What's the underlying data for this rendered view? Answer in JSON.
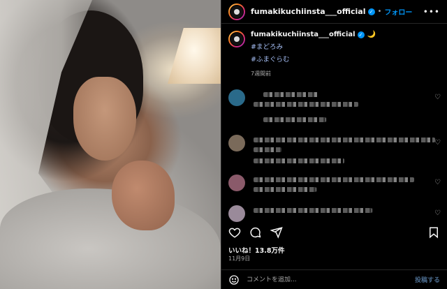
{
  "post": {
    "username": "fumakikuchiinsta___official",
    "follow_label": "フォロー",
    "separator": "•",
    "more_label": "•••",
    "verified_mark": "✓"
  },
  "caption": {
    "username": "fumakikuchiinsta___official",
    "moon_emoji": "🌙",
    "hashtags": [
      "#まどろみ",
      "#ふまぐらむ"
    ],
    "age": "7週間前"
  },
  "engagement": {
    "likes": "いいね！13.8万件",
    "date": "11月9日"
  },
  "composer": {
    "placeholder": "コメントを追加...",
    "post_label": "投稿する"
  },
  "icons": {
    "like": "heart-icon",
    "comment": "comment-icon",
    "share": "send-icon",
    "save": "bookmark-icon",
    "emoji": "emoji-icon",
    "comment_heart": "heart-icon"
  },
  "colors": {
    "accent_link": "#0095f6",
    "hashtag": "#a6bff5",
    "muted_text": "#a8a8a8",
    "background": "#000000"
  }
}
